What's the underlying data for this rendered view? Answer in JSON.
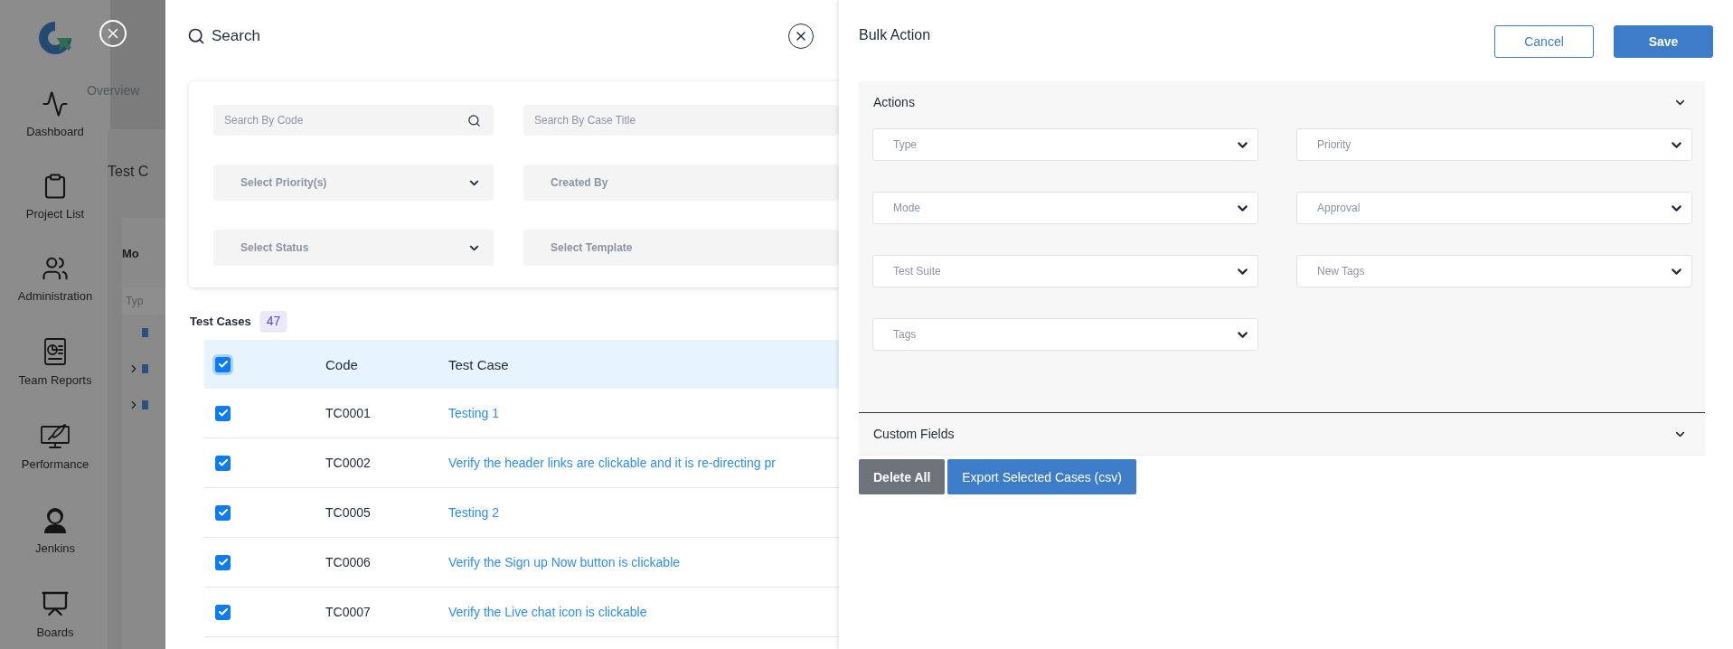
{
  "sidebar": {
    "items": [
      {
        "kind": "dashboard",
        "label": "Dashboard"
      },
      {
        "kind": "projects",
        "label": "Project List"
      },
      {
        "kind": "admin",
        "label": "Administration"
      },
      {
        "kind": "reports",
        "label": "Team Reports"
      },
      {
        "kind": "performance",
        "label": "Performance"
      },
      {
        "kind": "jenkins",
        "label": "Jenkins"
      },
      {
        "kind": "boards",
        "label": "Boards"
      }
    ]
  },
  "background": {
    "tab": "Overview",
    "card_title": "Test C",
    "panel_heading": "Mo",
    "filter_placeholder": "Typ",
    "tree": [
      {
        "kind": "leaf"
      },
      {
        "kind": "branch"
      },
      {
        "kind": "branch"
      }
    ]
  },
  "search_panel": {
    "title": "Search",
    "filters": [
      {
        "kind": "search",
        "placeholder": "Search By Code"
      },
      {
        "kind": "text",
        "placeholder": "Search By Case Title"
      },
      {
        "kind": "select",
        "placeholder": "Select Priority(s)",
        "chevron": true
      },
      {
        "kind": "select",
        "placeholder": "Created By",
        "chevron": false
      },
      {
        "kind": "select",
        "placeholder": "Select Status",
        "chevron": true
      },
      {
        "kind": "select",
        "placeholder": "Select Template",
        "chevron": false
      }
    ],
    "list_title": "Test Cases",
    "count": "47",
    "table": {
      "columns": [
        "Code",
        "Test Case"
      ],
      "all_checked": true,
      "rows": [
        {
          "checked": true,
          "code": "TC0001",
          "title": "Testing 1"
        },
        {
          "checked": true,
          "code": "TC0002",
          "title": "Verify the header links are clickable and it is re-directing pr"
        },
        {
          "checked": true,
          "code": "TC0005",
          "title": "Testing 2"
        },
        {
          "checked": true,
          "code": "TC0006",
          "title": "Verify the Sign up Now button is clickable"
        },
        {
          "checked": true,
          "code": "TC0007",
          "title": "Verify the Live chat icon is clickable"
        }
      ]
    }
  },
  "bulk_panel": {
    "title": "Bulk Action",
    "cancel": "Cancel",
    "save": "Save",
    "sections": [
      {
        "title": "Actions",
        "expanded": true,
        "fields": [
          "Type",
          "Priority",
          "Mode",
          "Approval",
          "Test Suite",
          "New Tags",
          "Tags"
        ]
      },
      {
        "title": "Custom Fields",
        "expanded": false
      }
    ],
    "buttons": [
      {
        "kind": "secondary",
        "label": "Delete All"
      },
      {
        "kind": "primary",
        "label": "Export Selected Cases (csv)"
      }
    ]
  }
}
